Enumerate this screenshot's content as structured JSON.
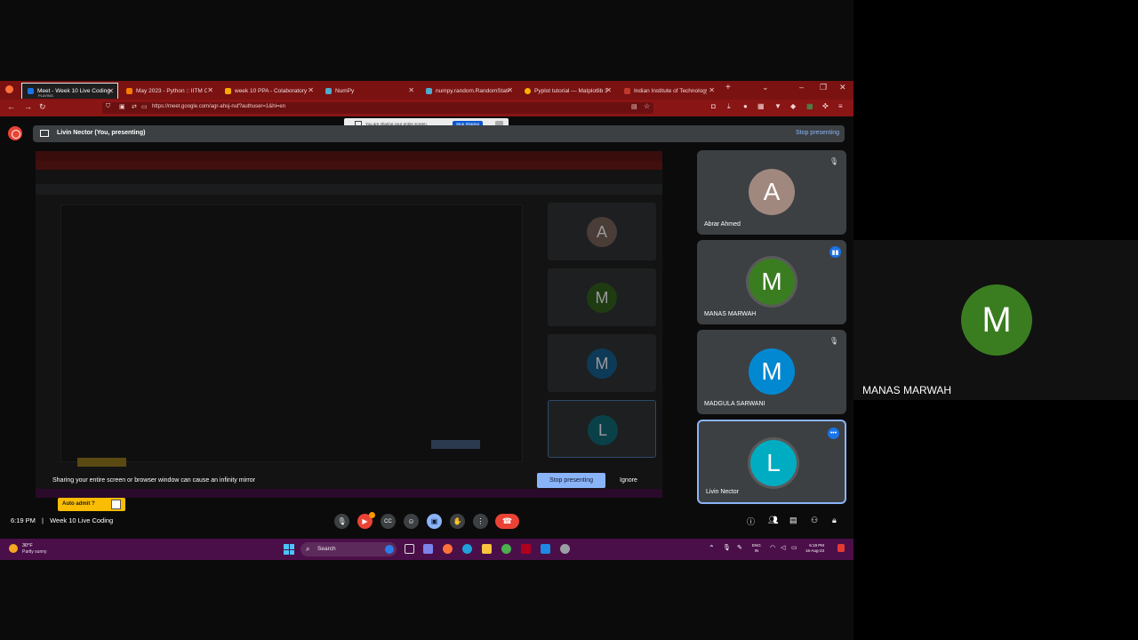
{
  "browser": {
    "tabs": [
      {
        "label": "Meet - Week 10 Live Coding",
        "sub": "PLAYING",
        "color": "#1a73e8",
        "active": true
      },
      {
        "label": "May 2023 - Python :: IITM Onlin",
        "color": "#f57c00"
      },
      {
        "label": "week 10 PPA - Colaboratory",
        "color": "#f9ab00"
      },
      {
        "label": "NumPy",
        "color": "#4dabcf"
      },
      {
        "label": "numpy.random.RandomState ::",
        "color": "#4dabcf"
      },
      {
        "label": "Pyplot tutorial — Matplotlib 3.",
        "color": "#ffb000"
      },
      {
        "label": "Indian Institute of Technology M",
        "color": "#c0392b"
      }
    ],
    "url": "https://meet.google.com/agr-ahsj-nuf?authuser=1&hl=en"
  },
  "meet": {
    "presenter_label": "Livin Nector (You, presenting)",
    "stop_presenting_top": "Stop presenting",
    "share_notice": "You are sharing your entire screen.",
    "stop_sharing": "Stop Sharing",
    "mirror_warning": "Sharing your entire screen or browser window can cause an infinity mirror",
    "stop_presenting_btn": "Stop presenting",
    "ignore": "Ignore",
    "auto_admit": "Auto admit ?",
    "time": "6:19 PM",
    "separator": "|",
    "meeting_title": "Week 10 Live Coding",
    "participants": [
      {
        "name": "Abrar Ahmed",
        "initial": "A",
        "color": "#a1887f",
        "icon": "mic-off-icon"
      },
      {
        "name": "MANAS MARWAH",
        "initial": "M",
        "color": "#3a7d21",
        "icon": "speaking-icon"
      },
      {
        "name": "MADGULA SARWANI",
        "initial": "M",
        "color": "#0288d1",
        "icon": "mic-off-icon"
      },
      {
        "name": "Livin Nector",
        "initial": "L",
        "color": "#00acc1",
        "icon": "more-icon"
      }
    ],
    "ghost_tiles": [
      {
        "initial": "A",
        "color": "#4a3c37"
      },
      {
        "initial": "M",
        "color": "#1e3b12"
      },
      {
        "initial": "M",
        "color": "#0d3a57"
      },
      {
        "initial": "L",
        "color": "#0a4149"
      }
    ]
  },
  "taskbar": {
    "temp": "30°F",
    "weather": "Partly sunny",
    "search": "Search",
    "lang_top": "ENG",
    "lang_bottom": "IN",
    "clock": "6:19 PM",
    "date": "16-Aug-23"
  },
  "spotlight": {
    "initial": "M",
    "name": "MANAS MARWAH"
  }
}
